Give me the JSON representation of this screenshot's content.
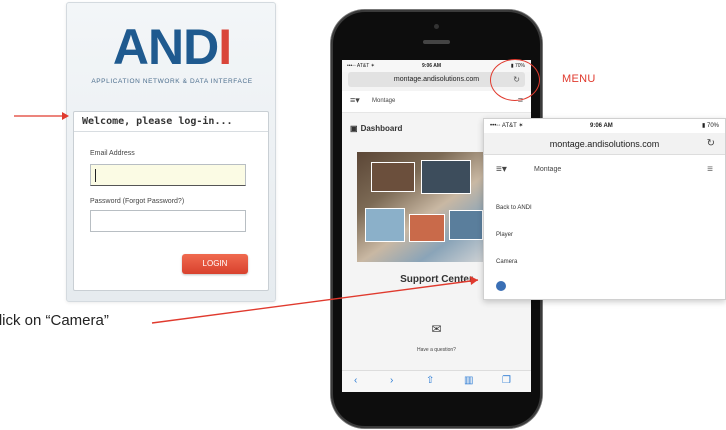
{
  "login": {
    "logo_part1": "AND",
    "logo_part2": "I",
    "logo_subtitle": "Application Network & Data Interface",
    "welcome": "Welcome, please log-in...",
    "email_label": "Email Address",
    "password_label": "Password (Forgot Password?)",
    "login_button": "LOGIN"
  },
  "annotations": {
    "instruction": "Click on “Camera”",
    "menu_label": "MENU",
    "accent_color": "#e03a2e"
  },
  "phone": {
    "status_carrier": "•••◦◦ AT&T ✶",
    "status_time": "9:06 AM",
    "status_battery": "▮ 70%",
    "url": "montage.andisolutions.com",
    "reload_icon": "↻",
    "menu_icon": "≡▾",
    "nav_title": "Montage",
    "hamburger_icon": "≡",
    "dashboard_icon": "▣",
    "dashboard": "Dashboard",
    "support": "Support Center",
    "chat_icon": "✉",
    "question": "Have a question?",
    "toolbar": [
      "‹",
      "›",
      "⇧",
      "▥",
      "❐"
    ]
  },
  "dropdown": {
    "status_carrier": "•••◦◦ AT&T ✶",
    "status_time": "9:06 AM",
    "status_battery": "▮ 70%",
    "url": "montage.andisolutions.com",
    "reload_icon": "↻",
    "menu_icon": "≡▾",
    "nav_title": "Montage",
    "hamburger_icon": "≡",
    "items": [
      "Back to ANDI",
      "Player",
      "Camera"
    ]
  }
}
